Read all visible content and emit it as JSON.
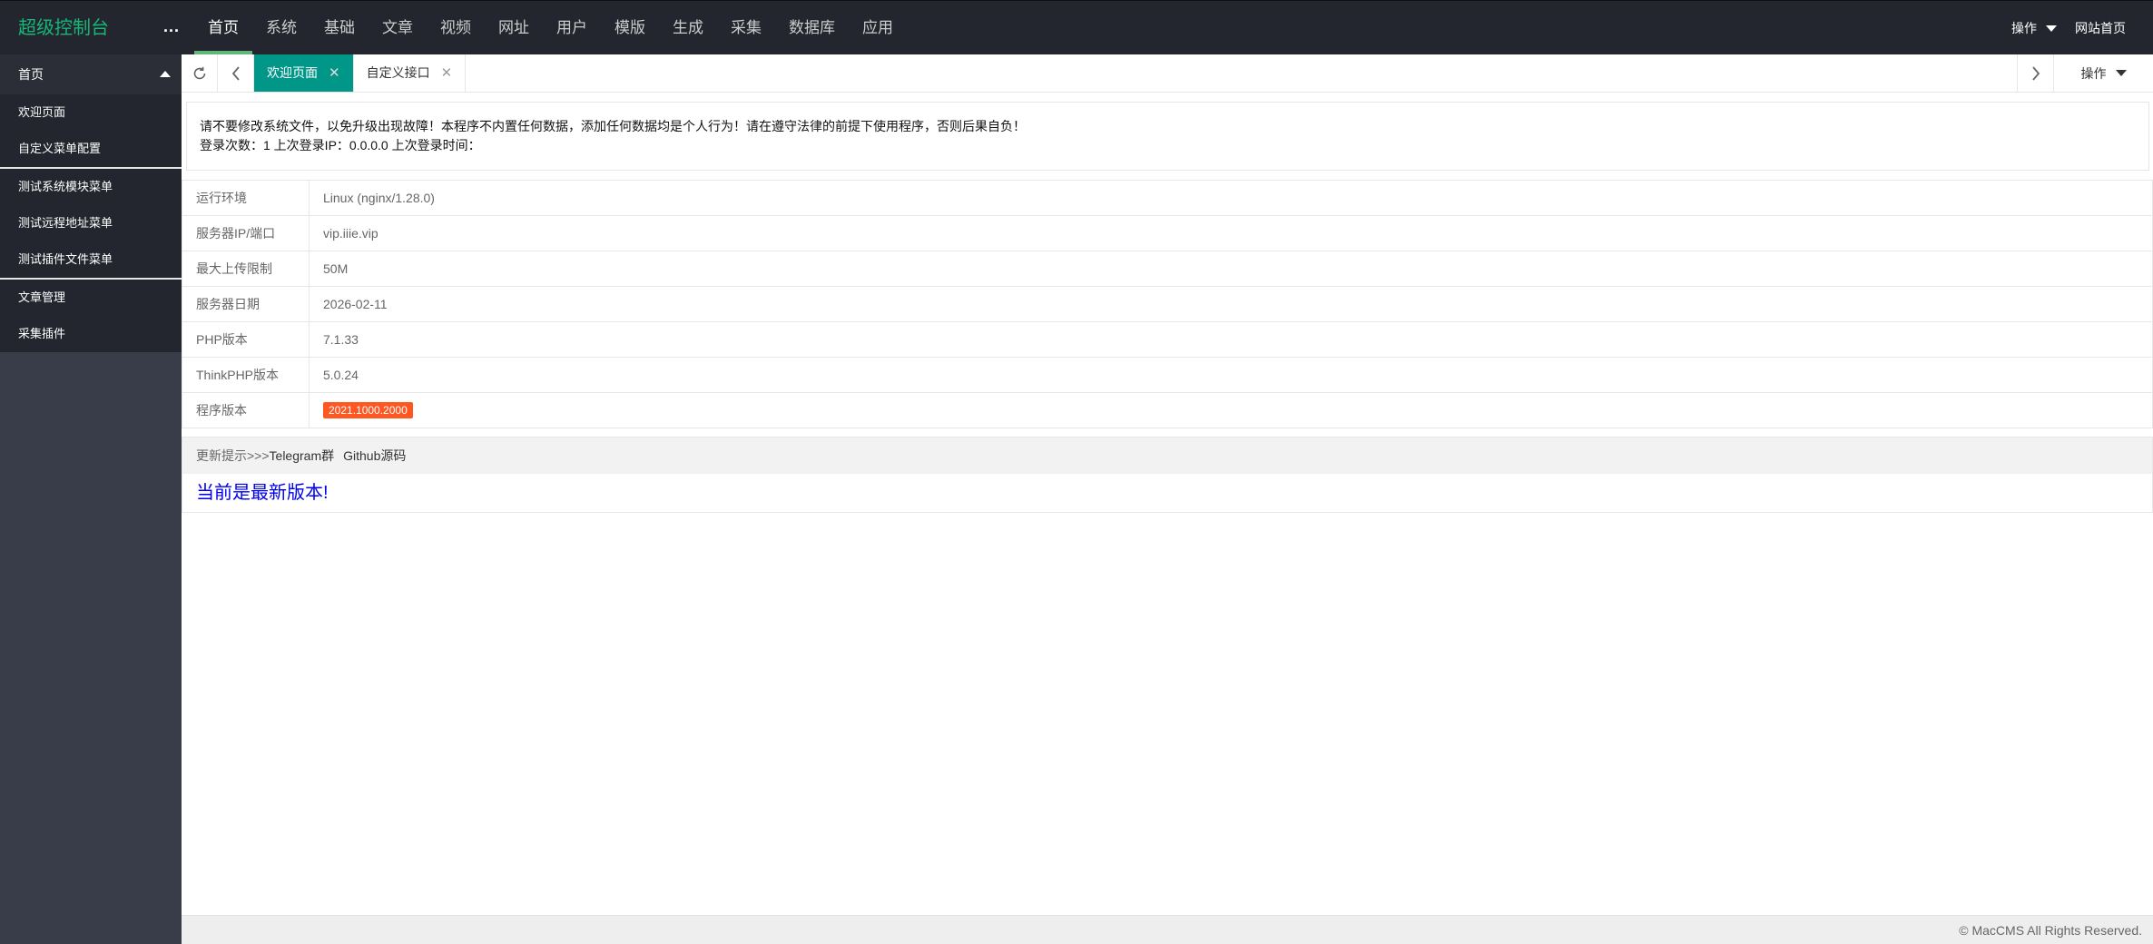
{
  "header": {
    "logo": "超级控制台",
    "more": "...",
    "nav": [
      "首页",
      "系统",
      "基础",
      "文章",
      "视频",
      "网址",
      "用户",
      "模版",
      "生成",
      "采集",
      "数据库",
      "应用"
    ],
    "ops_label": "操作",
    "home_label": "网站首页"
  },
  "sidebar": {
    "title": "首页",
    "groups": [
      [
        "欢迎页面",
        "自定义菜单配置"
      ],
      [
        "测试系统模块菜单",
        "测试远程地址菜单",
        "测试插件文件菜单"
      ],
      [
        "文章管理",
        "采集插件"
      ]
    ]
  },
  "tabs": {
    "items": [
      {
        "label": "欢迎页面",
        "active": true
      },
      {
        "label": "自定义接口",
        "active": false
      }
    ],
    "ops_label": "操作"
  },
  "notice": {
    "line1": "请不要修改系统文件，以免升级出现故障！本程序不内置任何数据，添加任何数据均是个人行为！请在遵守法律的前提下使用程序，否则后果自负！",
    "line2": "登录次数：1 上次登录IP：0.0.0.0 上次登录时间："
  },
  "info": {
    "rows": [
      {
        "key": "运行环境",
        "value": "Linux (nginx/1.28.0)"
      },
      {
        "key": "服务器IP/端口",
        "value": "vip.iiie.vip"
      },
      {
        "key": "最大上传限制",
        "value": "50M"
      },
      {
        "key": "服务器日期",
        "value": "2026-02-11"
      },
      {
        "key": "PHP版本",
        "value": "7.1.33"
      },
      {
        "key": "ThinkPHP版本",
        "value": "5.0.24"
      },
      {
        "key": "程序版本",
        "value": "2021.1000.2000"
      }
    ]
  },
  "update": {
    "prefix": "更新提示>>>",
    "link1": "Telegram群",
    "link2": "Github源码",
    "message": "当前是最新版本!"
  },
  "footer": {
    "copyright": "© MacCMS All Rights Reserved."
  },
  "colors": {
    "header_bg": "#23262e",
    "sidebar_bg": "#393d49",
    "logo": "#16b777",
    "active_tab": "#009688",
    "badge": "#ff5722",
    "nav_active_bar": "#5fb878"
  }
}
